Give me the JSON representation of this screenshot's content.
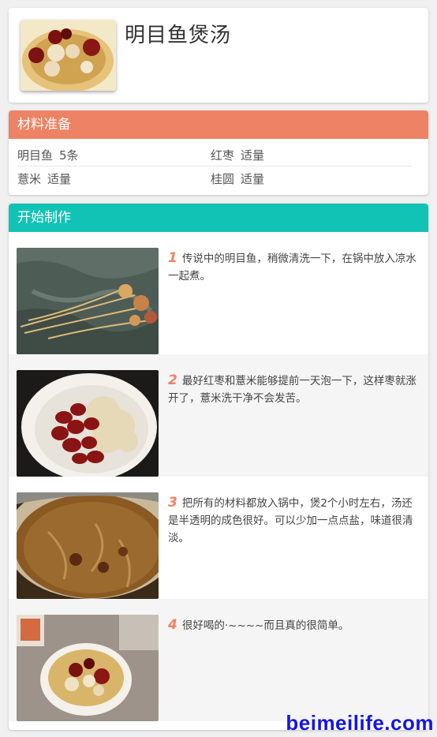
{
  "recipe": {
    "title": "明目鱼煲汤"
  },
  "ingredients": {
    "header": "材料准备",
    "items": [
      {
        "name": "明目鱼",
        "amount": "5条"
      },
      {
        "name": "红枣",
        "amount": "适量"
      },
      {
        "name": "薏米",
        "amount": "适量"
      },
      {
        "name": "桂圆",
        "amount": "适量"
      }
    ]
  },
  "steps": {
    "header": "开始制作",
    "items": [
      {
        "num": "1",
        "text": "传说中的明目鱼，稍微清洗一下，在锅中放入凉水一起煮。"
      },
      {
        "num": "2",
        "text": "最好红枣和薏米能够提前一天泡一下，这样枣就涨开了，薏米洗干净不会发苦。"
      },
      {
        "num": "3",
        "text": "把所有的材料都放入锅中，煲2个小时左右，汤还是半透明的成色很好。可以少加一点点盐，味道很清淡。"
      },
      {
        "num": "4",
        "text": "很好喝的·~~~~而且真的很简单。"
      }
    ]
  },
  "watermark": "beimeilife.com",
  "colors": {
    "ingredients_bar": "#ee8264",
    "steps_bar": "#10c3b4",
    "step_number": "#ee8264",
    "watermark": "#1515e6"
  }
}
